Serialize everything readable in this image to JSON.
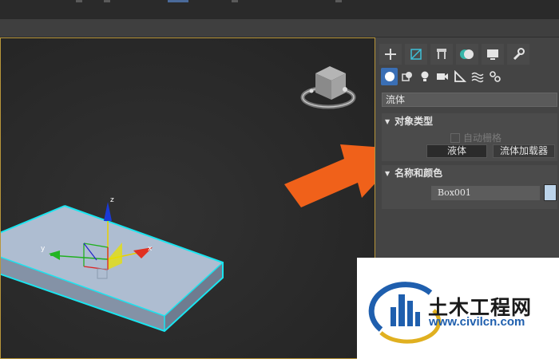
{
  "panel": {
    "object_category": "流体",
    "rollout_object_type": {
      "title": "对象类型",
      "checkbox_label": "自动栅格",
      "buttons": [
        "液体",
        "流体加载器"
      ]
    },
    "rollout_name_color": {
      "title": "名称和颜色",
      "object_name": "Box001",
      "object_color": "#bcd4ea"
    }
  },
  "viewport": {
    "axis_labels": {
      "x": "x",
      "y": "y",
      "z": "z"
    }
  },
  "watermark": {
    "name": "土木工程网",
    "url": "www.civilcn.com"
  },
  "colors": {
    "selection_outline": "#19e5f0",
    "arrow": "#f0611a",
    "accent": "#3a6fb5"
  }
}
